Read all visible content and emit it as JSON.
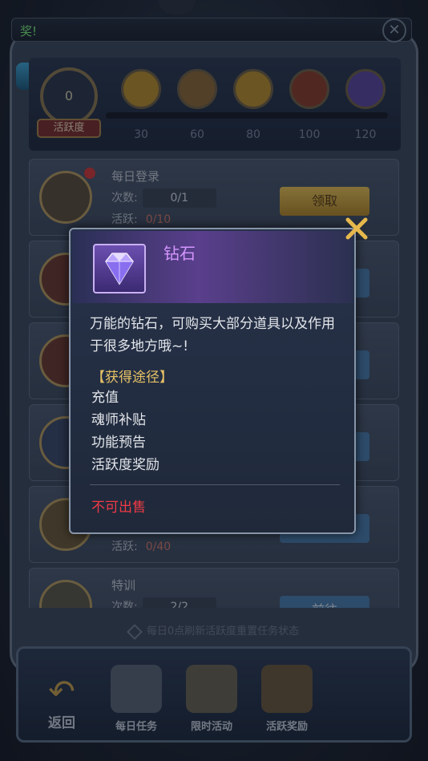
{
  "topbar": {
    "text": "奖!"
  },
  "activity": {
    "value": "0",
    "label": "活跃度",
    "milestones": [
      {
        "value": "30"
      },
      {
        "value": "60"
      },
      {
        "value": "80"
      },
      {
        "value": "100"
      },
      {
        "value": "120"
      }
    ]
  },
  "tasks": [
    {
      "title": "每日登录",
      "count_label": "次数:",
      "count": "0/1",
      "active_label": "活跃:",
      "active": "0/10",
      "button": "领取"
    },
    {
      "title": "",
      "count_label": "",
      "count": "",
      "active_label": "",
      "active": "",
      "button": ""
    },
    {
      "title": "",
      "count_label": "",
      "count": "",
      "active_label": "",
      "active": "",
      "button": ""
    },
    {
      "title": "",
      "count_label": "",
      "count": "",
      "active_label": "",
      "active": "",
      "button": ""
    },
    {
      "title": "",
      "count_label": "",
      "count": "",
      "active_label": "活跃:",
      "active": "0/40",
      "button": ""
    },
    {
      "title": "特训",
      "count_label": "次数:",
      "count": "2/2",
      "active_label": "",
      "active": "",
      "button": "前往"
    }
  ],
  "refresh_note": "每日0点刷新活跃度重置任务状态",
  "bottom_nav": {
    "back": "返回",
    "tabs": [
      "每日任务",
      "限时活动",
      "活跃奖励"
    ]
  },
  "popup": {
    "item_name": "钻石",
    "item_icon": "diamond-icon",
    "description": "万能的钻石，可购买大部分道具以及作用于很多地方哦~!",
    "obtain_title": "【获得途径】",
    "obtain_methods": [
      "充值",
      "魂师补贴",
      "功能预告",
      "活跃度奖励"
    ],
    "sell_status": "不可出售",
    "colors": {
      "name": "#d596ff",
      "obtain_title": "#e7c266",
      "sell_status": "#ef3a45",
      "close": "#e6b84c"
    }
  }
}
